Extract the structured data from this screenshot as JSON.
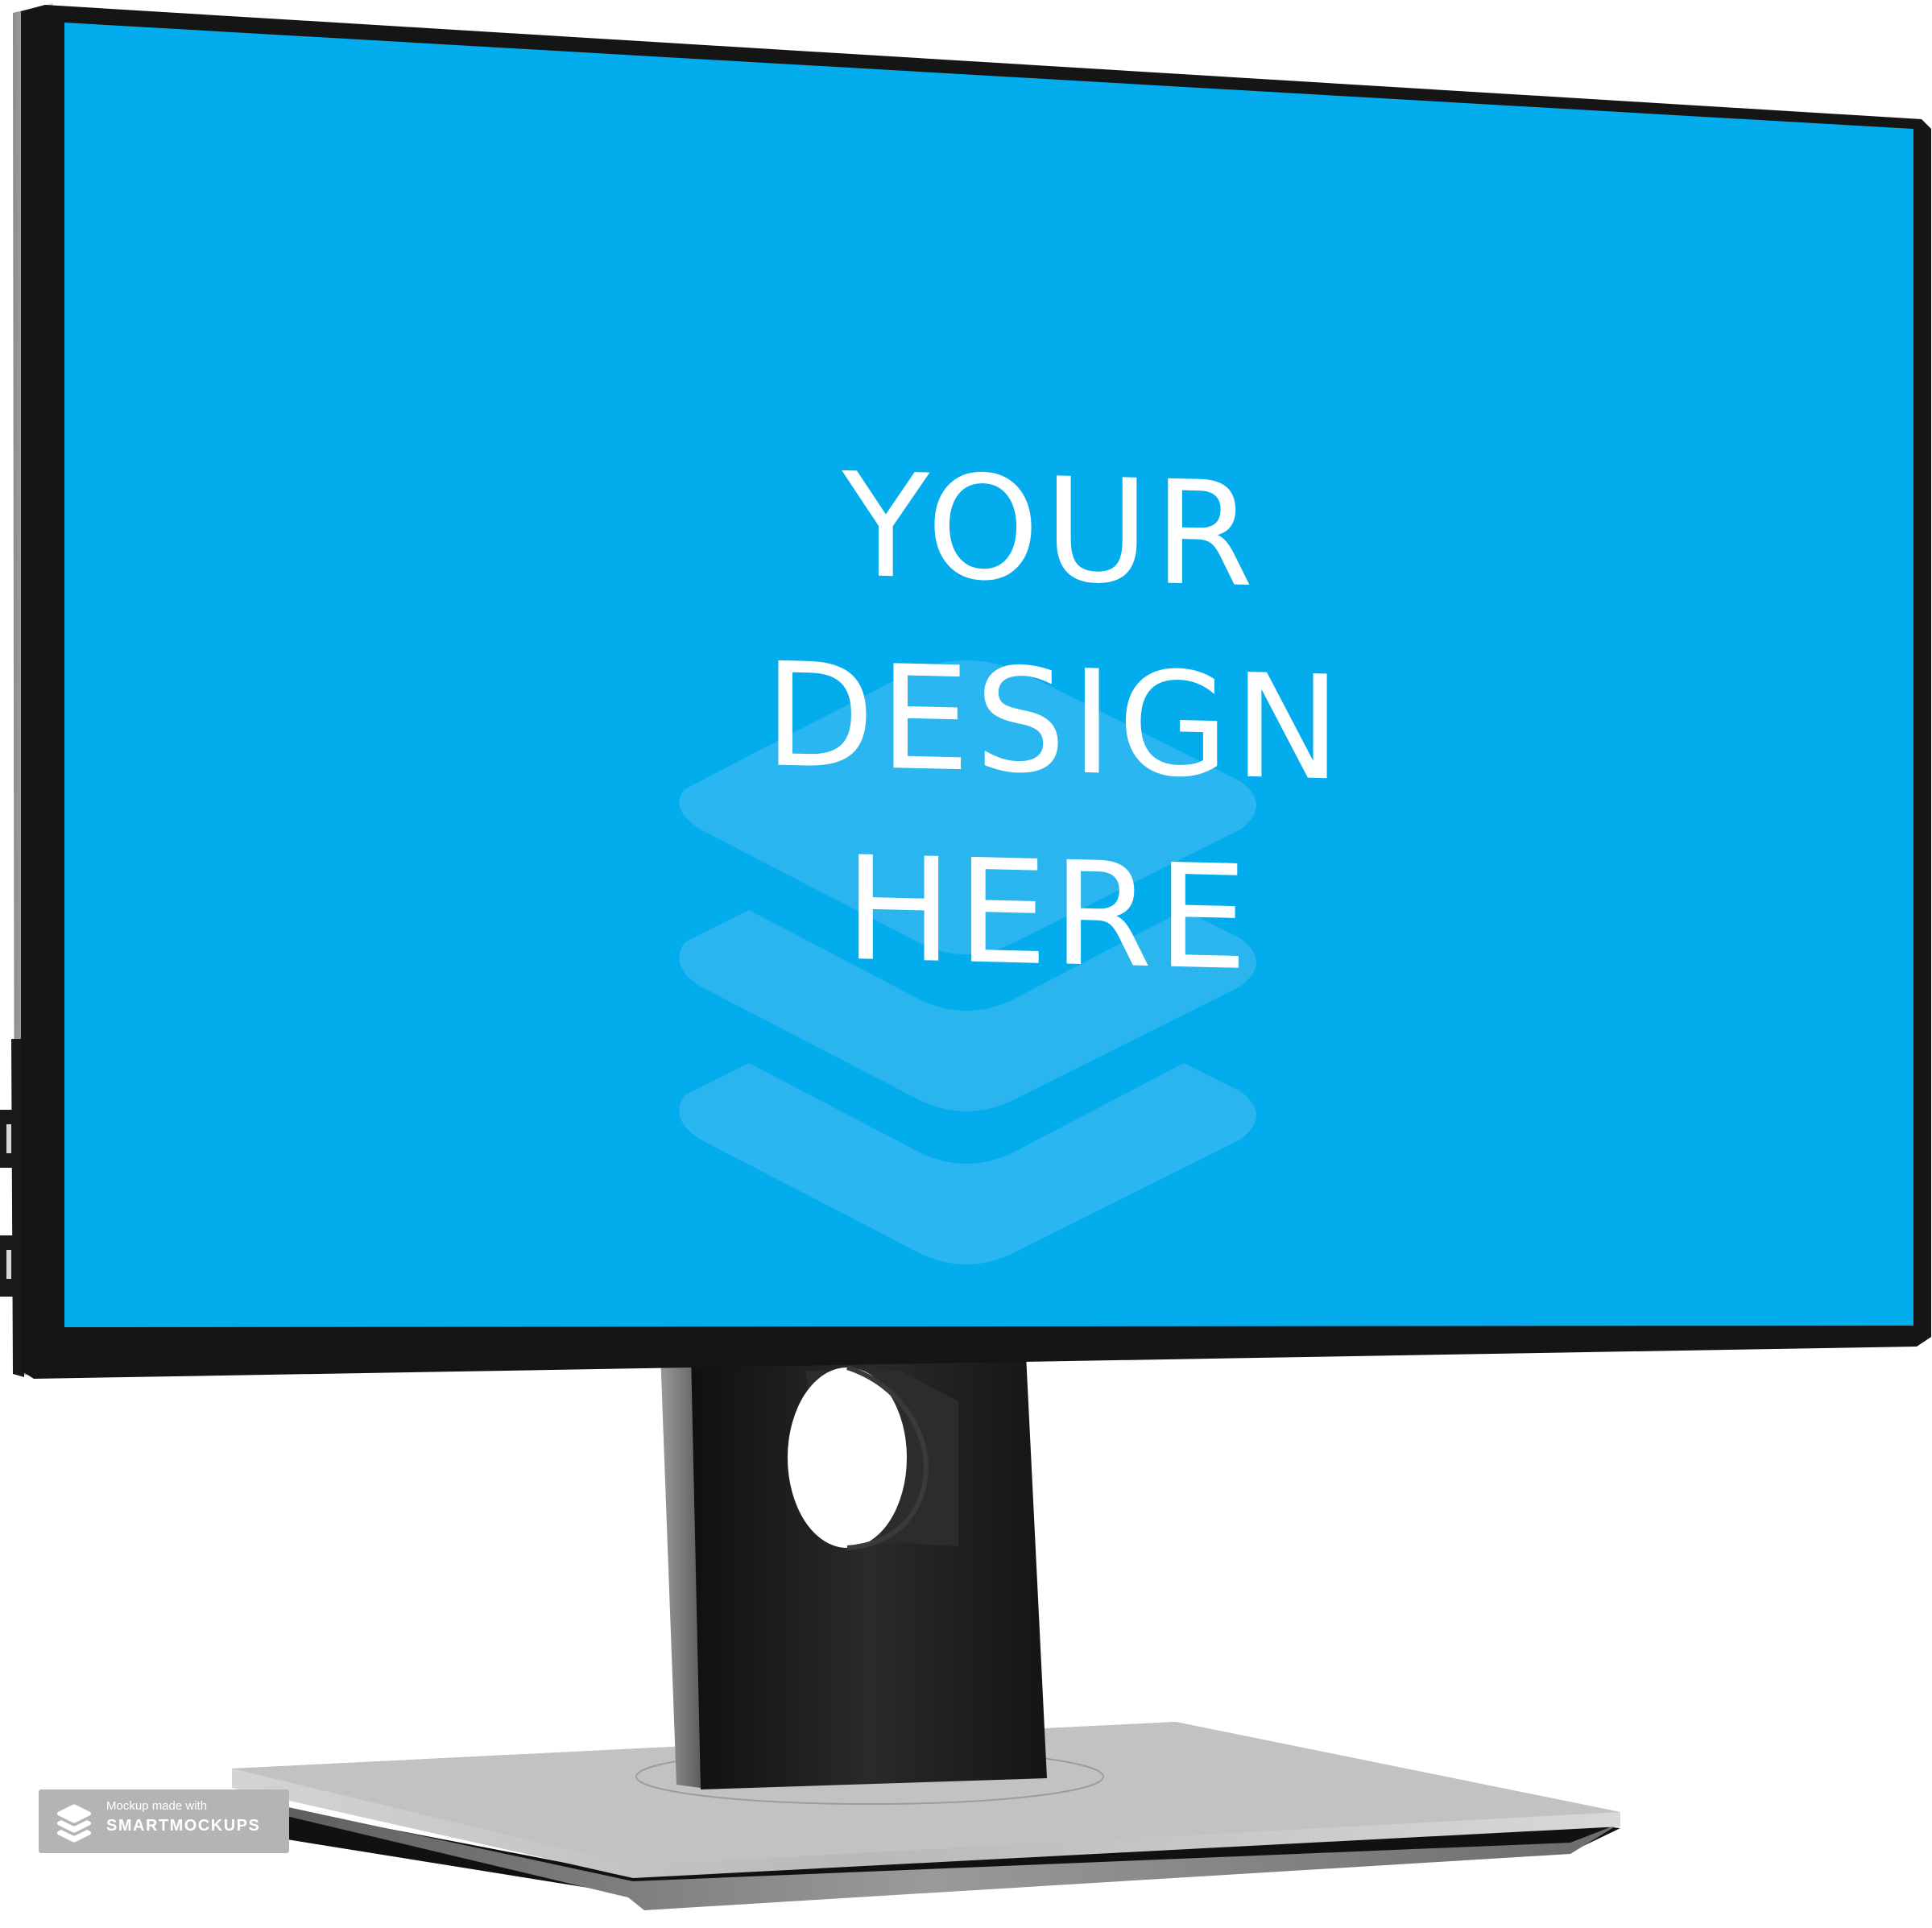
{
  "mockup": {
    "device": "desktop monitor",
    "screen_color": "#03aced",
    "bezel_color": "#151515",
    "stand_color": "#1e1e1e",
    "base_color": "#bcbcbc",
    "screen_lines": [
      "YOUR",
      "DESIGN",
      "HERE"
    ],
    "screen_logo_icon": "layers-icon"
  },
  "watermark": {
    "line1": "Mockup made with",
    "line2": "SMARTMOCKUPS",
    "icon": "layers-icon"
  }
}
